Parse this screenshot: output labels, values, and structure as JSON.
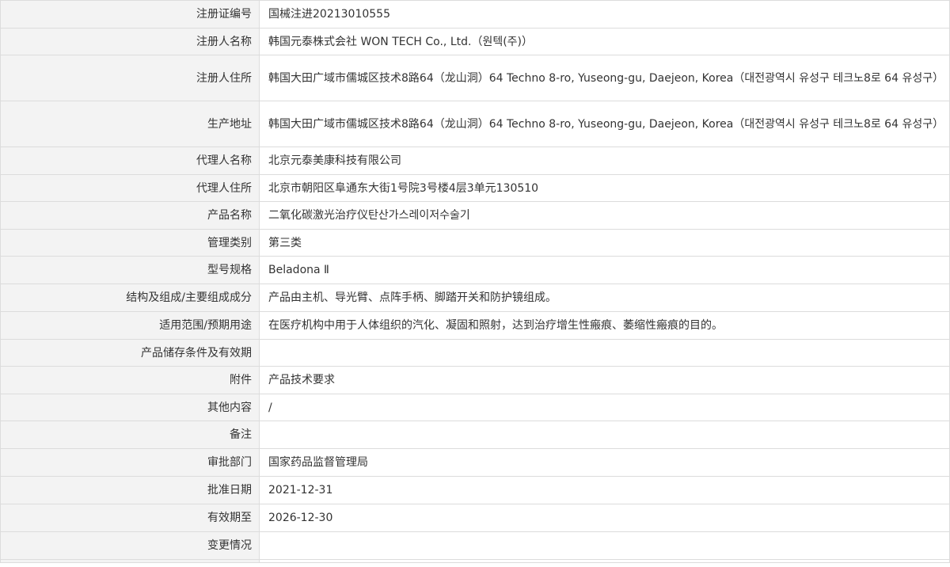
{
  "rows": [
    {
      "label": "注册证编号",
      "value": "国械注进20213010555"
    },
    {
      "label": "注册人名称",
      "value": "韩国元泰株式会社 WON TECH Co., Ltd.（원텍(주)）"
    },
    {
      "label": "注册人住所",
      "value": "韩国大田广域市儒城区技术8路64（龙山洞）64 Techno 8-ro, Yuseong-gu, Daejeon, Korea（대전광역시 유성구 테크노8로 64 유성구）"
    },
    {
      "label": "生产地址",
      "value": "韩国大田广域市儒城区技术8路64（龙山洞）64 Techno 8-ro, Yuseong-gu, Daejeon, Korea（대전광역시 유성구 테크노8로 64 유성구）"
    },
    {
      "label": "代理人名称",
      "value": "北京元泰美康科技有限公司"
    },
    {
      "label": "代理人住所",
      "value": "北京市朝阳区阜通东大街1号院3号楼4层3单元130510"
    },
    {
      "label": "产品名称",
      "value": "二氧化碳激光治疗仪탄산가스레이저수술기"
    },
    {
      "label": "管理类别",
      "value": "第三类"
    },
    {
      "label": "型号规格",
      "value": "Beladona Ⅱ"
    },
    {
      "label": "结构及组成/主要组成成分",
      "value": "产品由主机、导光臂、点阵手柄、脚踏开关和防护镜组成。"
    },
    {
      "label": "适用范围/预期用途",
      "value": "在医疗机构中用于人体组织的汽化、凝固和照射，达到治疗增生性瘢痕、萎缩性瘢痕的目的。"
    },
    {
      "label": "产品储存条件及有效期",
      "value": ""
    },
    {
      "label": "附件",
      "value": "产品技术要求"
    },
    {
      "label": "其他内容",
      "value": "/"
    },
    {
      "label": "备注",
      "value": ""
    },
    {
      "label": "审批部门",
      "value": "国家药品监督管理局"
    },
    {
      "label": "批准日期",
      "value": "2021-12-31"
    },
    {
      "label": "有效期至",
      "value": "2026-12-30"
    },
    {
      "label": "变更情况",
      "value": ""
    }
  ]
}
